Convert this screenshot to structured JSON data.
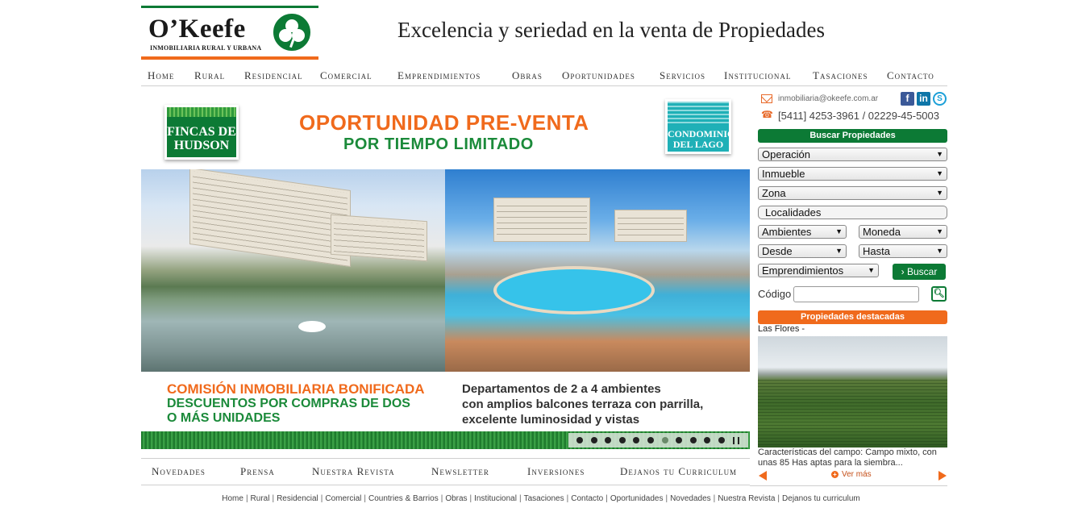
{
  "brand": {
    "name": "O’Keefe",
    "subtitle": "INMOBILIARIA RURAL Y URBANA",
    "tagline": "Excelencia y seriedad en la venta de Propiedades",
    "colors": {
      "green": "#0c7a35",
      "orange": "#f06a1c"
    }
  },
  "topnav": [
    "Home",
    "Rural",
    "Residencial",
    "Comercial",
    "Emprendimientos",
    "Obras",
    "Oportunidades",
    "Servicios",
    "Institucional",
    "Tasaciones",
    "Contacto"
  ],
  "banner": {
    "badge_left": "FINCAS DE HUDSON",
    "badge_right": "CONDOMINIOS DEL LAGO",
    "headline": "OPORTUNIDAD PRE-VENTA",
    "subheadline": "POR TIEMPO LIMITADO",
    "bottom_orange": "COMISIÓN INMOBILIARIA BONIFICADA",
    "bottom_green_1": "DESCUENTOS POR COMPRAS DE DOS",
    "bottom_green_2": "O MÁS UNIDADES",
    "bottom_right_1": "Departamentos de 2 a 4 ambientes",
    "bottom_right_2": "con amplios balcones terraza con parrilla,",
    "bottom_right_3": "excelente luminosidad y vistas",
    "slide_count": 11,
    "active_slide": 6
  },
  "contact": {
    "email": "inmobiliaria@okeefe.com.ar",
    "phone": "[5411] 4253-3961 / 02229-45-5003",
    "social": [
      "facebook-icon",
      "linkedin-icon",
      "skype-icon"
    ]
  },
  "search": {
    "header": "Buscar Propiedades",
    "operacion": "Operación",
    "inmueble": "Inmueble",
    "zona": "Zona",
    "localidades": "Localidades",
    "ambientes": "Ambientes",
    "moneda": "Moneda",
    "desde": "Desde",
    "hasta": "Hasta",
    "emprendimientos": "Emprendimientos",
    "button": "Buscar",
    "code_label": "Código",
    "code_value": ""
  },
  "featured": {
    "header": "Propiedades destacadas",
    "title": "Las Flores -",
    "description": "Características del campo: Campo mixto, con unas 85 Has aptas para la siembra...",
    "more": "Ver más"
  },
  "subnav": [
    "Novedades",
    "Prensa",
    "Nuestra Revista",
    "Newsletter",
    "Inversiones",
    "Dejanos tu Curriculum"
  ],
  "footer": [
    "Home",
    "Rural",
    "Residencial",
    "Comercial",
    "Countries & Barrios",
    "Obras",
    "Institucional",
    "Tasaciones",
    "Contacto",
    "Oportunidades",
    "Novedades",
    "Nuestra Revista",
    "Dejanos tu curriculum"
  ]
}
